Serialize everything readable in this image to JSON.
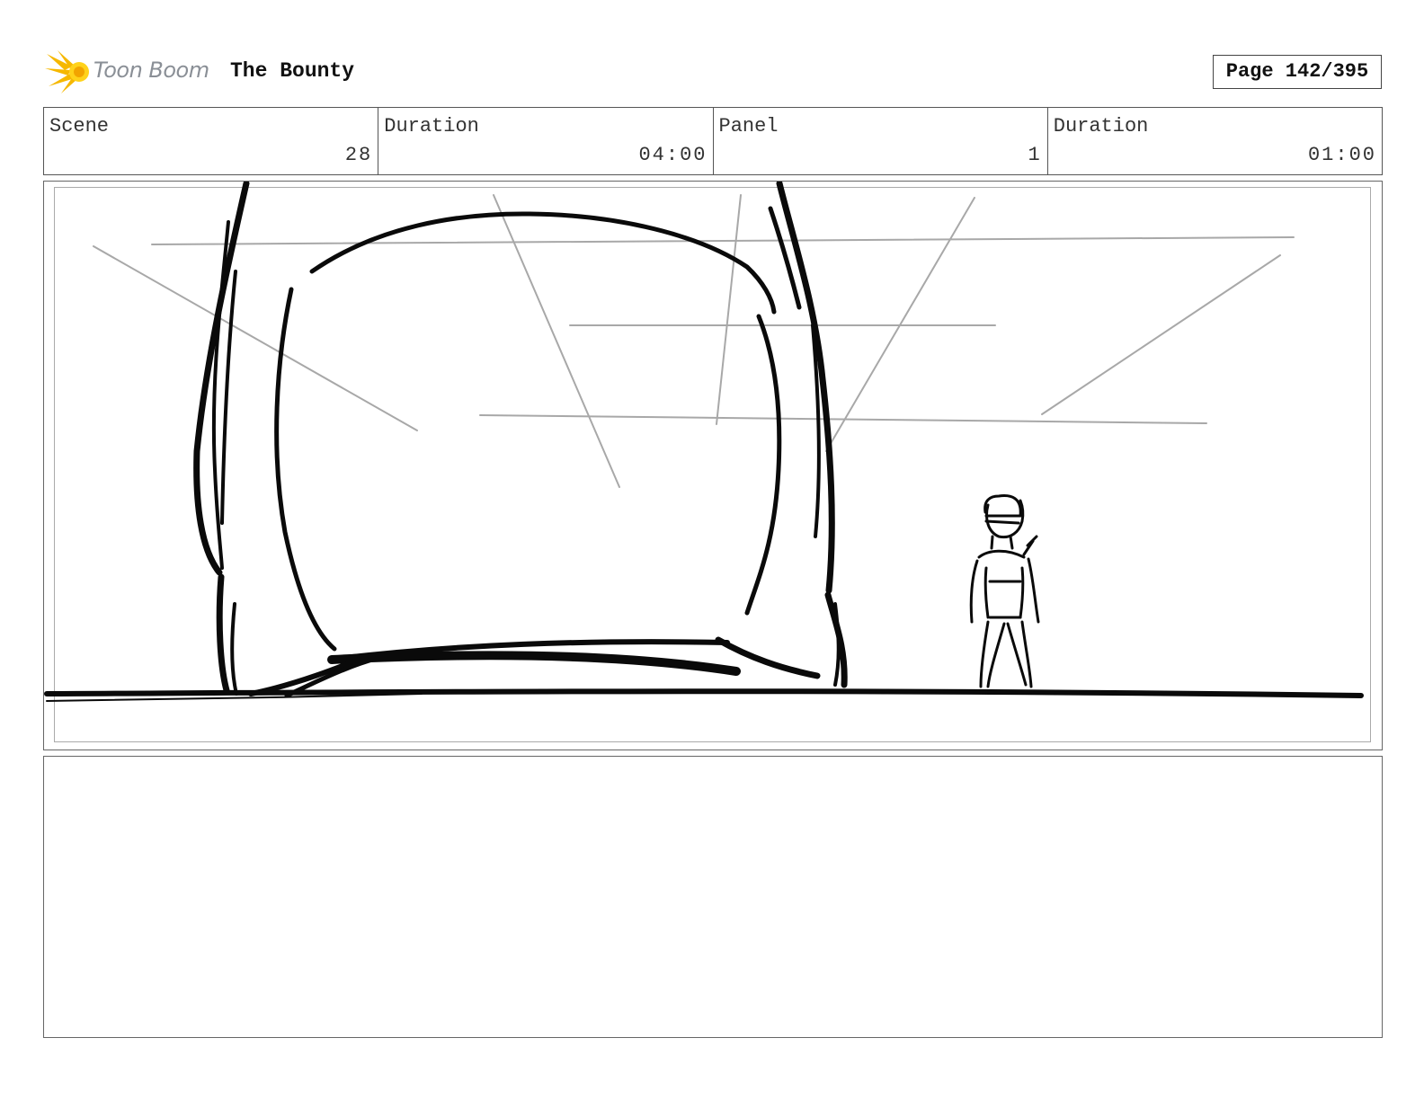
{
  "header": {
    "logo_text": "Toon Boom",
    "project_title": "The Bounty",
    "page_label": "Page 142/395"
  },
  "info": {
    "scene_label": "Scene",
    "scene_value": "28",
    "scene_duration_label": "Duration",
    "scene_duration_value": "04:00",
    "panel_label": "Panel",
    "panel_value": "1",
    "panel_duration_label": "Duration",
    "panel_duration_value": "01:00"
  },
  "colors": {
    "logo_star": "#f6b800",
    "logo_text": "#8a8f96"
  }
}
